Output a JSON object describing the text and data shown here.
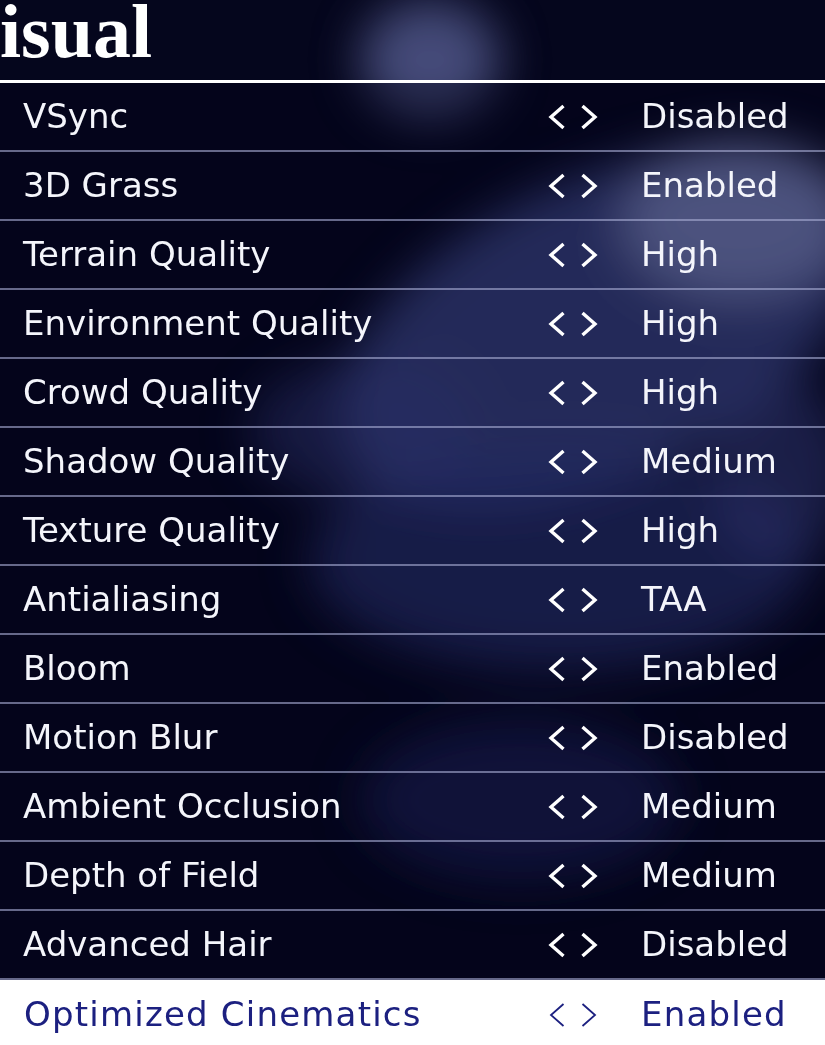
{
  "header": {
    "title": "isual"
  },
  "settings": [
    {
      "label": "VSync",
      "value": "Disabled",
      "selected": false
    },
    {
      "label": "3D Grass",
      "value": "Enabled",
      "selected": false
    },
    {
      "label": "Terrain Quality",
      "value": "High",
      "selected": false
    },
    {
      "label": "Environment Quality",
      "value": "High",
      "selected": false
    },
    {
      "label": "Crowd Quality",
      "value": "High",
      "selected": false
    },
    {
      "label": "Shadow Quality",
      "value": "Medium",
      "selected": false
    },
    {
      "label": "Texture Quality",
      "value": "High",
      "selected": false
    },
    {
      "label": "Antialiasing",
      "value": "TAA",
      "selected": false
    },
    {
      "label": "Bloom",
      "value": "Enabled",
      "selected": false
    },
    {
      "label": "Motion Blur",
      "value": "Disabled",
      "selected": false
    },
    {
      "label": "Ambient Occlusion",
      "value": "Medium",
      "selected": false
    },
    {
      "label": "Depth of Field",
      "value": "Medium",
      "selected": false
    },
    {
      "label": "Advanced Hair",
      "value": "Disabled",
      "selected": false
    },
    {
      "label": "Optimized Cinematics",
      "value": "Enabled",
      "selected": true
    }
  ]
}
